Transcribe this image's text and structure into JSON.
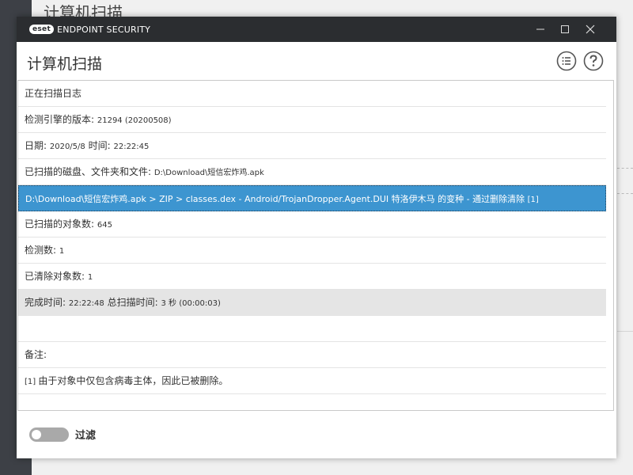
{
  "background": {
    "title": "计算机扫描"
  },
  "window": {
    "brand_badge": "eset",
    "brand_text": "ENDPOINT SECURITY",
    "controls": [
      "minimize-icon",
      "maximize-icon",
      "close-icon"
    ]
  },
  "dialog": {
    "title": "计算机扫描",
    "icons": [
      "list-icon",
      "help-icon"
    ]
  },
  "log": {
    "rows": [
      {
        "label": "正在扫描日志",
        "value": ""
      },
      {
        "label": "检测引擎的版本: ",
        "value": "21294 (20200508)"
      },
      {
        "label": "日期: ",
        "value": "2020/5/8",
        "label2": "  时间: ",
        "value2": "22:22:45"
      },
      {
        "label": "已扫描的磁盘、文件夹和文件: ",
        "value": "D:\\Download\\短信宏炸鸡.apk"
      },
      {
        "label": "D:\\Download\\短信宏炸鸡.apk > ZIP > classes.dex - Android/TrojanDropper.Agent.DUI 特洛伊木马 的变种 - 通过删除清除 ",
        "value": "[1]"
      },
      {
        "label": "已扫描的对象数: ",
        "value": "645"
      },
      {
        "label": "检测数: ",
        "value": "1"
      },
      {
        "label": "已清除对象数: ",
        "value": "1"
      },
      {
        "label": "完成时间: ",
        "value": "22:22:48",
        "label2": "  总扫描时间: ",
        "value2": "3 秒 (00:00:03)"
      },
      {
        "label": "",
        "value": ""
      },
      {
        "label": "备注:",
        "value": ""
      },
      {
        "label": "由于对象中仅包含病毒主体，因此已被删除。",
        "prefix": "[1] "
      }
    ]
  },
  "footer": {
    "filter_label": "过滤",
    "filter_on": false
  },
  "colors": {
    "selected_row": "#3d95d0",
    "titlebar": "#2b2d30",
    "toggle_off": "#a9a9a9"
  }
}
